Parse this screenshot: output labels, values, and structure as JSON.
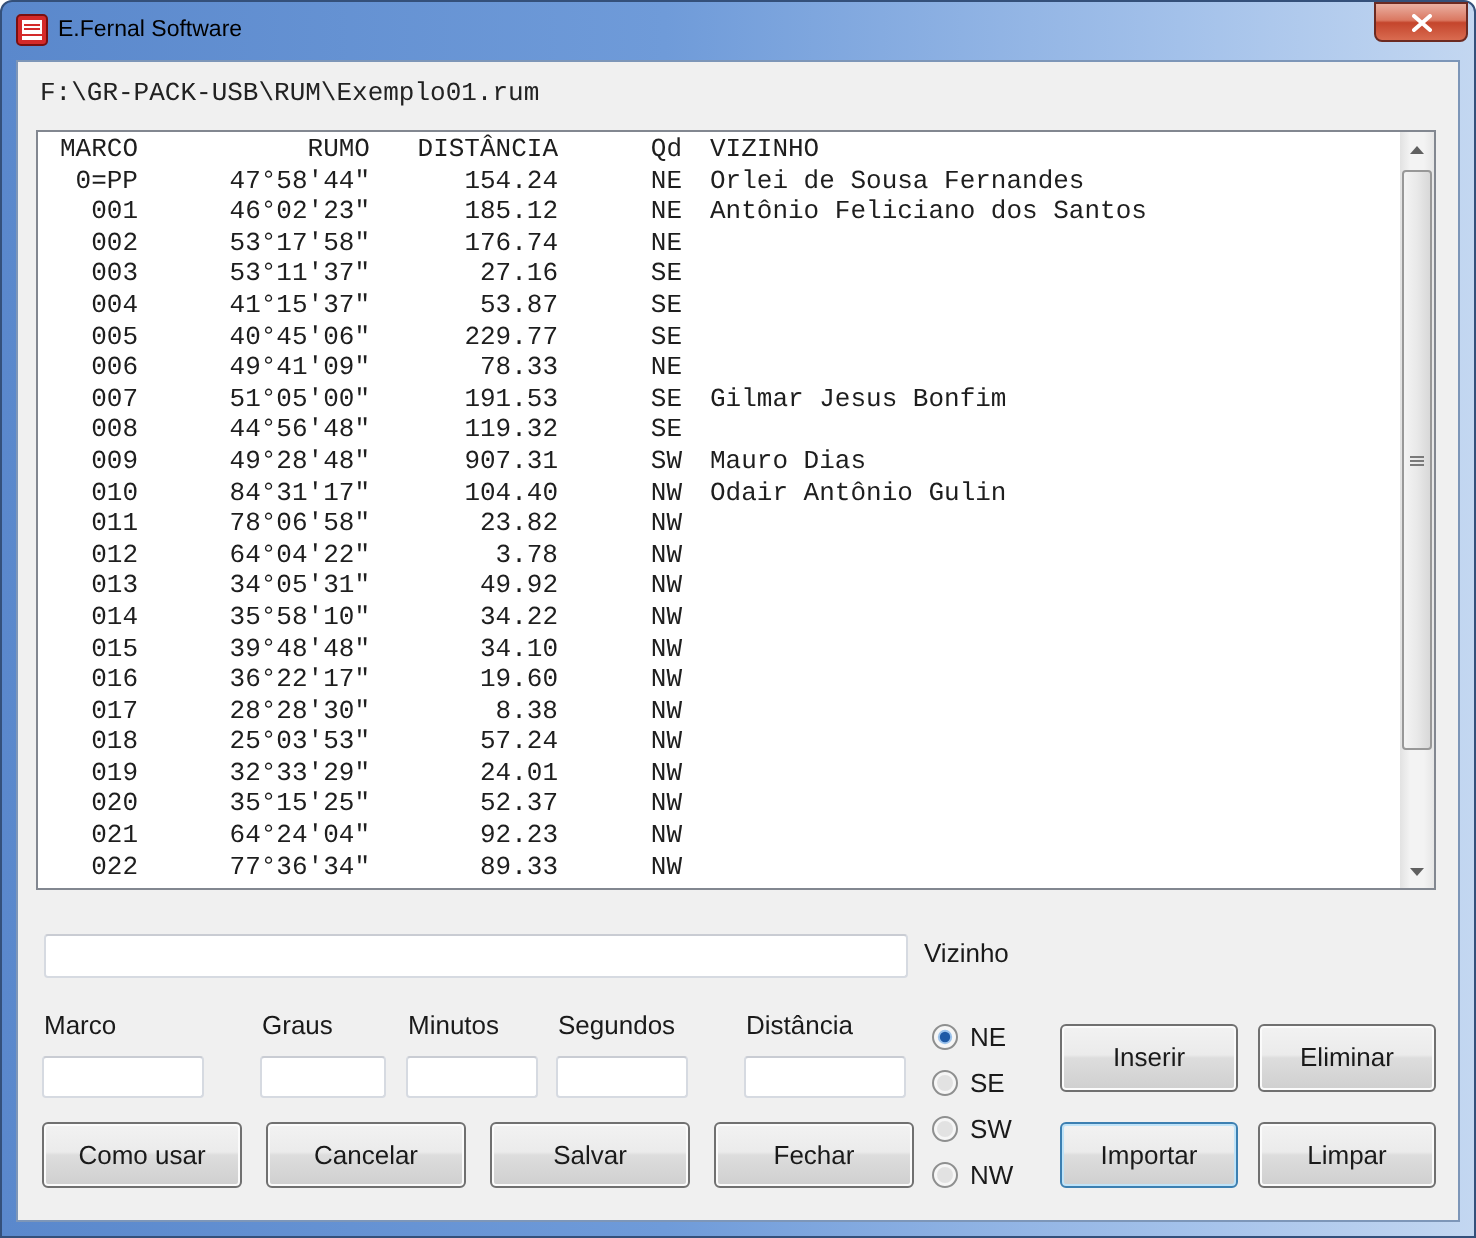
{
  "window": {
    "title": "E.Fernal Software"
  },
  "file_path": "F:\\GR-PACK-USB\\RUM\\Exemplo01.rum",
  "list": {
    "columns": [
      "MARCO",
      "RUMO",
      "DISTÂNCIA",
      "Qd",
      "VIZINHO"
    ],
    "rows": [
      [
        "0=PP",
        "47°58'44\"",
        "154.24",
        "NE",
        "Orlei de Sousa Fernandes"
      ],
      [
        "001",
        "46°02'23\"",
        "185.12",
        "NE",
        "Antônio Feliciano dos Santos"
      ],
      [
        "002",
        "53°17'58\"",
        "176.74",
        "NE"
      ],
      [
        "003",
        "53°11'37\"",
        "27.16",
        "SE"
      ],
      [
        "004",
        "41°15'37\"",
        "53.87",
        "SE"
      ],
      [
        "005",
        "40°45'06\"",
        "229.77",
        "SE"
      ],
      [
        "006",
        "49°41'09\"",
        "78.33",
        "NE"
      ],
      [
        "007",
        "51°05'00\"",
        "191.53",
        "SE",
        "Gilmar Jesus Bonfim"
      ],
      [
        "008",
        "44°56'48\"",
        "119.32",
        "SE"
      ],
      [
        "009",
        "49°28'48\"",
        "907.31",
        "SW",
        "Mauro Dias"
      ],
      [
        "010",
        "84°31'17\"",
        "104.40",
        "NW",
        "Odair Antônio Gulin"
      ],
      [
        "011",
        "78°06'58\"",
        "23.82",
        "NW"
      ],
      [
        "012",
        "64°04'22\"",
        "3.78",
        "NW"
      ],
      [
        "013",
        "34°05'31\"",
        "49.92",
        "NW"
      ],
      [
        "014",
        "35°58'10\"",
        "34.22",
        "NW"
      ],
      [
        "015",
        "39°48'48\"",
        "34.10",
        "NW"
      ],
      [
        "016",
        "36°22'17\"",
        "19.60",
        "NW"
      ],
      [
        "017",
        "28°28'30\"",
        "8.38",
        "NW"
      ],
      [
        "018",
        "25°03'53\"",
        "57.24",
        "NW"
      ],
      [
        "019",
        "32°33'29\"",
        "24.01",
        "NW"
      ],
      [
        "020",
        "35°15'25\"",
        "52.37",
        "NW"
      ],
      [
        "021",
        "64°24'04\"",
        "92.23",
        "NW"
      ],
      [
        "022",
        "77°36'34\"",
        "89.33",
        "NW"
      ]
    ]
  },
  "vizinho_field": {
    "label": "Vizinho"
  },
  "fields": [
    {
      "label": "Marco"
    },
    {
      "label": "Graus"
    },
    {
      "label": "Minutos"
    },
    {
      "label": "Segundos"
    },
    {
      "label": "Distância"
    }
  ],
  "buttons": [
    {
      "label": "Como usar",
      "focused": false
    },
    {
      "label": "Cancelar",
      "focused": false
    },
    {
      "label": "Salvar",
      "focused": false
    },
    {
      "label": "Fechar",
      "focused": false
    }
  ],
  "quadrant": [
    {
      "label": "NE",
      "selected": true
    },
    {
      "label": "SE",
      "selected": false
    },
    {
      "label": "SW",
      "selected": false
    },
    {
      "label": "NW",
      "selected": false
    }
  ],
  "action_buttons": [
    {
      "label": "Inserir",
      "focused": false
    },
    {
      "label": "Eliminar",
      "focused": false
    },
    {
      "label": "Importar",
      "focused": true
    },
    {
      "label": "Limpar",
      "focused": false
    }
  ]
}
